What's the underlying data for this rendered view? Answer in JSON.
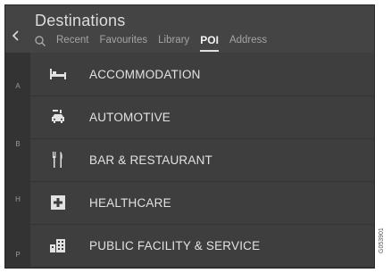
{
  "header": {
    "title": "Destinations",
    "tabs": [
      {
        "label": "Recent",
        "active": false
      },
      {
        "label": "Favourites",
        "active": false
      },
      {
        "label": "Library",
        "active": false
      },
      {
        "label": "POI",
        "active": true
      },
      {
        "label": "Address",
        "active": false
      }
    ],
    "search_icon": "search-icon",
    "back_icon": "chevron-left-icon"
  },
  "index_letters": [
    "A",
    "B",
    "H",
    "P"
  ],
  "poi_list": [
    {
      "label": "ACCOMMODATION",
      "icon": "bed-icon"
    },
    {
      "label": "AUTOMOTIVE",
      "icon": "car-icon"
    },
    {
      "label": "BAR & RESTAURANT",
      "icon": "fork-knife-icon"
    },
    {
      "label": "HEALTHCARE",
      "icon": "medical-cross-icon"
    },
    {
      "label": "PUBLIC FACILITY & SERVICE",
      "icon": "building-icon"
    }
  ],
  "figure_code": "G053901",
  "colors": {
    "background": "#3b3b3b",
    "text": "#e2e2e2",
    "tab_inactive": "#a4a4a4"
  }
}
